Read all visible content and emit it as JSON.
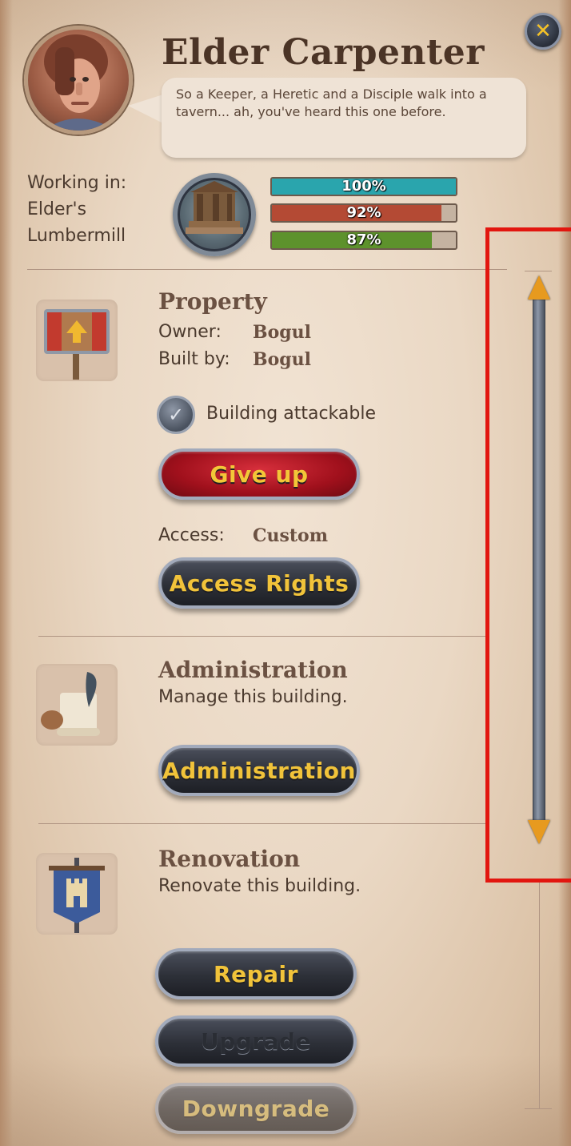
{
  "header": {
    "title": "Elder Carpenter",
    "speech": "So a Keeper, a Heretic and a Disciple walk into a tavern... ah, you've heard this one before.",
    "close_icon": "close-x-icon"
  },
  "working": {
    "label": "Working in:",
    "place_line1": "Elder's",
    "place_line2": "Lumbermill"
  },
  "stats": [
    {
      "label": "100%",
      "value": 1.0,
      "color": "#2aa5ad"
    },
    {
      "label": "92%",
      "value": 0.92,
      "color": "#b44a34"
    },
    {
      "label": "87%",
      "value": 0.87,
      "color": "#5d922c"
    }
  ],
  "property": {
    "title": "Property",
    "owner_label": "Owner:",
    "owner_value": "Bogul",
    "builtby_label": "Built by:",
    "builtby_value": "Bogul",
    "attackable_label": "Building attackable",
    "give_up_label": "Give up",
    "access_label": "Access:",
    "access_value": "Custom",
    "access_rights_label": "Access Rights"
  },
  "administration": {
    "title": "Administration",
    "description": "Manage this building.",
    "button_label": "Administration"
  },
  "renovation": {
    "title": "Renovation",
    "description": "Renovate this building.",
    "repair_label": "Repair",
    "upgrade_label": "Upgrade",
    "downgrade_label": "Downgrade"
  },
  "colors": {
    "accent_gold": "#f1c33a",
    "highlight_frame": "#e2160f"
  }
}
